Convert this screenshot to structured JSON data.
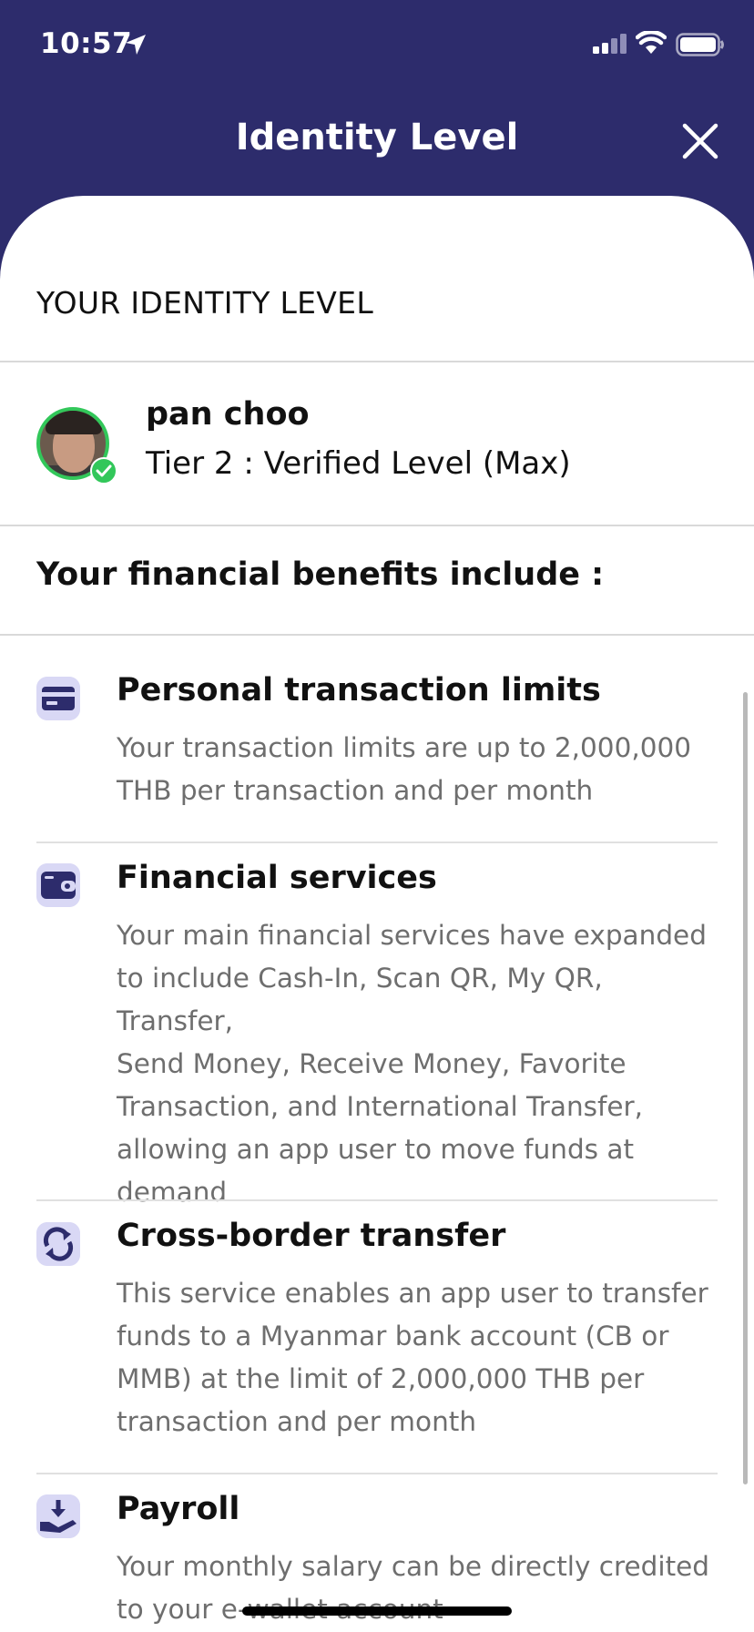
{
  "status_bar": {
    "time": "10:57"
  },
  "header": {
    "title": "Identity Level"
  },
  "identity": {
    "section_title": "YOUR IDENTITY LEVEL",
    "user_name": "pan choo",
    "tier": "Tier 2 : Verified Level (Max)"
  },
  "benefits": {
    "heading": "Your financial benefits include :",
    "items": [
      {
        "icon": "card-icon",
        "title": "Personal transaction limits",
        "lines": [
          "Your transaction limits are up to 2,000,000",
          "THB per transaction and per month"
        ]
      },
      {
        "icon": "wallet-icon",
        "title": "Financial services",
        "lines": [
          "Your main financial services have expanded",
          "to include Cash-In, Scan QR, My QR, Transfer,",
          "Send Money, Receive Money, Favorite",
          "Transaction, and International Transfer,",
          "allowing an app user to move funds at",
          "demand"
        ]
      },
      {
        "icon": "exchange-icon",
        "title": "Cross-border transfer",
        "lines": [
          "This service enables an app user to transfer",
          "funds to a Myanmar bank account (CB or",
          "MMB) at the limit of 2,000,000 THB per",
          "transaction and per month"
        ]
      },
      {
        "icon": "salary-hand-icon",
        "title": "Payroll",
        "lines": [
          "Your monthly salary can be directly credited",
          "to your e-wallet account"
        ]
      }
    ]
  },
  "colors": {
    "header_bg": "#2d2c6c",
    "icon_bg": "#d9d8f5",
    "icon_fg": "#2d2c6c",
    "verified_green": "#32c75a",
    "muted_text": "#6e6e6e"
  }
}
